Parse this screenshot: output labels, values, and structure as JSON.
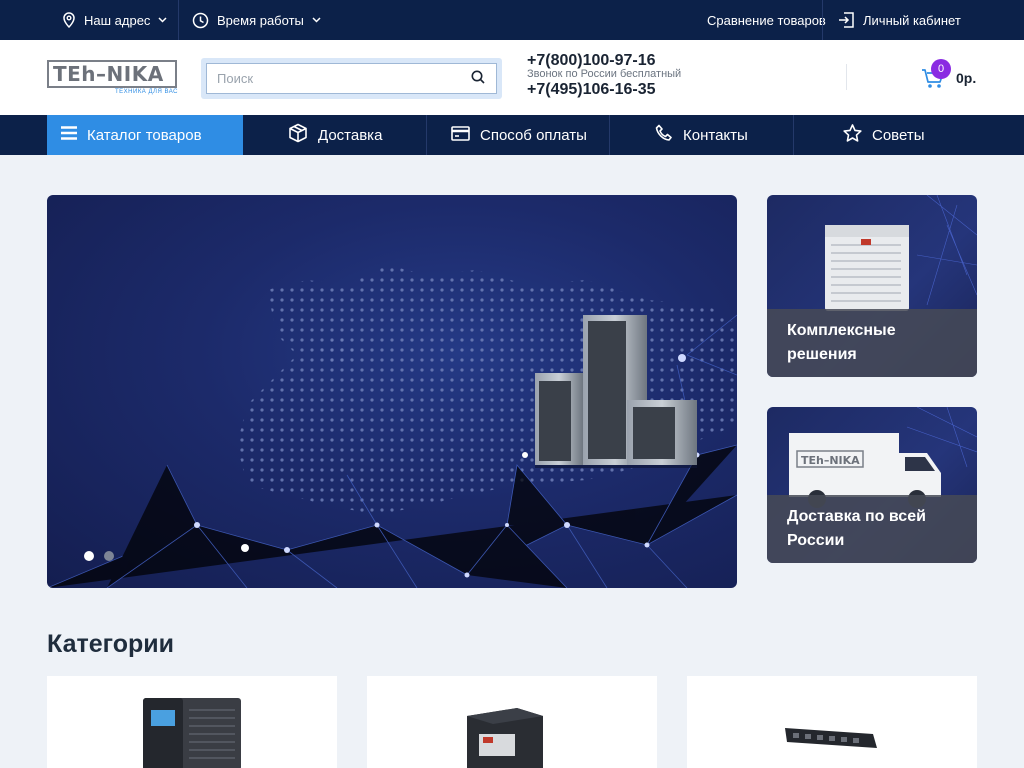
{
  "topbar": {
    "address_label": "Наш адрес",
    "hours_label": "Время работы",
    "compare_label": "Сравнение товаров",
    "account_label": "Личный кабинет"
  },
  "header": {
    "logo_text_part1": "TEh",
    "logo_text_part2": "–NIKA",
    "logo_tagline": "ТЕХНИКА ДЛЯ ВАС",
    "search_placeholder": "Поиск",
    "phone1": "+7(800)100-97-16",
    "phone_note": "Звонок по России бесплатный",
    "phone2": "+7(495)106-16-35",
    "cart_count": "0",
    "cart_sum": "0р."
  },
  "nav": {
    "catalog": "Каталог товаров",
    "items": [
      "Доставка",
      "Способ оплаты",
      "Контакты",
      "Советы"
    ]
  },
  "side_cards": [
    {
      "caption": "Комплексные решения"
    },
    {
      "caption": "Доставка по всей России"
    }
  ],
  "categories": {
    "title": "Категории"
  },
  "colors": {
    "topbar_bg": "#0c2149",
    "accent": "#2f8de4",
    "badge": "#8a2be2"
  }
}
